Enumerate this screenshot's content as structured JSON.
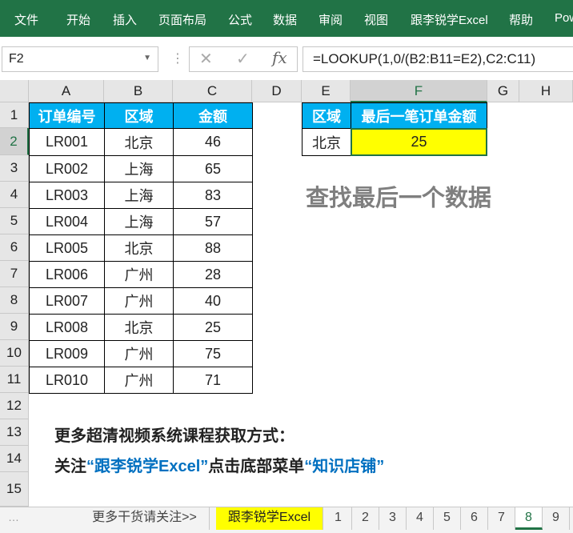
{
  "ribbon": {
    "tabs": [
      "文件",
      "开始",
      "插入",
      "页面布局",
      "公式",
      "数据",
      "审阅",
      "视图",
      "跟李锐学Excel",
      "帮助",
      "Pow"
    ]
  },
  "formula_bar": {
    "name_box": "F2",
    "formula": "=LOOKUP(1,0/(B2:B11=E2),C2:C11)",
    "cancel_icon": "✕",
    "enter_icon": "✓",
    "fx_label": "fx"
  },
  "columns": [
    "A",
    "B",
    "C",
    "D",
    "E",
    "F",
    "G",
    "H"
  ],
  "rows": [
    "1",
    "2",
    "3",
    "4",
    "5",
    "6",
    "7",
    "8",
    "9",
    "10",
    "11",
    "12",
    "13",
    "14",
    "15"
  ],
  "table": {
    "headers": [
      "订单编号",
      "区域",
      "金额"
    ],
    "rows": [
      [
        "LR001",
        "北京",
        "46"
      ],
      [
        "LR002",
        "上海",
        "65"
      ],
      [
        "LR003",
        "上海",
        "83"
      ],
      [
        "LR004",
        "上海",
        "57"
      ],
      [
        "LR005",
        "北京",
        "88"
      ],
      [
        "LR006",
        "广州",
        "28"
      ],
      [
        "LR007",
        "广州",
        "40"
      ],
      [
        "LR008",
        "北京",
        "25"
      ],
      [
        "LR009",
        "广州",
        "75"
      ],
      [
        "LR010",
        "广州",
        "71"
      ]
    ]
  },
  "lookup": {
    "header_region": "区域",
    "header_result": "最后一笔订单金额",
    "region": "北京",
    "result": "25"
  },
  "title": "查找最后一个数据",
  "promo": {
    "line1": "更多超清视频系统课程获取方式：",
    "line2_a": "关注",
    "line2_b": "“跟李锐学Excel”",
    "line2_c": "点击底部菜单",
    "line2_d": "“知识店铺”"
  },
  "sheet_tabs": {
    "more": "更多干货请关注>>",
    "brand": "跟李锐学Excel",
    "numbers": [
      "1",
      "2",
      "3",
      "4",
      "5",
      "6",
      "7",
      "8",
      "9"
    ],
    "active": "8"
  },
  "colors": {
    "ribbon": "#217346",
    "header_fill": "#00b0f0",
    "result_fill": "#ffff00",
    "title_gray": "#7f7f7f",
    "link_blue": "#0070c0"
  }
}
